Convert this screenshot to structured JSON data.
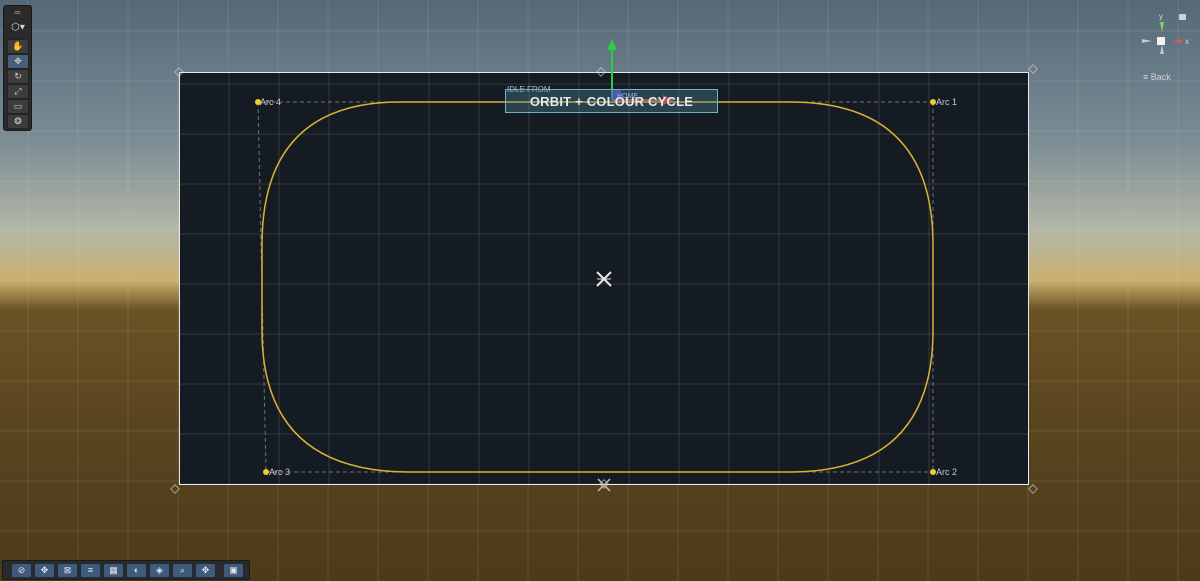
{
  "scene": {
    "title": "ORBIT + COLOUR CYCLE",
    "state_label": "IDLE FROM",
    "anchor_label": "HOME"
  },
  "arcs": [
    {
      "label": "Arc 1"
    },
    {
      "label": "Arc 2"
    },
    {
      "label": "Arc 3"
    },
    {
      "label": "Arc 4"
    }
  ],
  "tools": {
    "header": "═",
    "dropdown": "▾",
    "items": [
      {
        "icon": "hand-icon",
        "glyph": "✋",
        "active": false
      },
      {
        "icon": "move-icon",
        "glyph": "✥",
        "active": true
      },
      {
        "icon": "rotate-icon",
        "glyph": "↻",
        "active": false
      },
      {
        "icon": "scale-icon",
        "glyph": "⤢",
        "active": false
      },
      {
        "icon": "rect-icon",
        "glyph": "▭",
        "active": false
      },
      {
        "icon": "transform-icon",
        "glyph": "❂",
        "active": false
      }
    ]
  },
  "bottom_toolbar": [
    {
      "icon": "orbit-tool-icon",
      "glyph": "⊘"
    },
    {
      "icon": "move-tool-icon",
      "glyph": "✥"
    },
    {
      "icon": "collapse-icon",
      "glyph": "⊠"
    },
    {
      "icon": "sliders-icon",
      "glyph": "≡"
    },
    {
      "icon": "grid-toggle-icon",
      "glyph": "▦"
    },
    {
      "icon": "moon-icon",
      "glyph": "◐"
    },
    {
      "icon": "layers-icon",
      "glyph": "◈"
    },
    {
      "icon": "zoom-icon",
      "glyph": "⌕"
    },
    {
      "icon": "pan-icon",
      "glyph": "✥"
    },
    {
      "icon": "camera-icon",
      "glyph": "▣"
    }
  ],
  "gizmo": {
    "y_label": "y",
    "x_label": "x",
    "back_label": "≡ Back"
  },
  "colors": {
    "curve": "#d8b332",
    "point": "#f0d020",
    "y_axis": "#2ecc40",
    "x_axis": "#e23b3b"
  }
}
